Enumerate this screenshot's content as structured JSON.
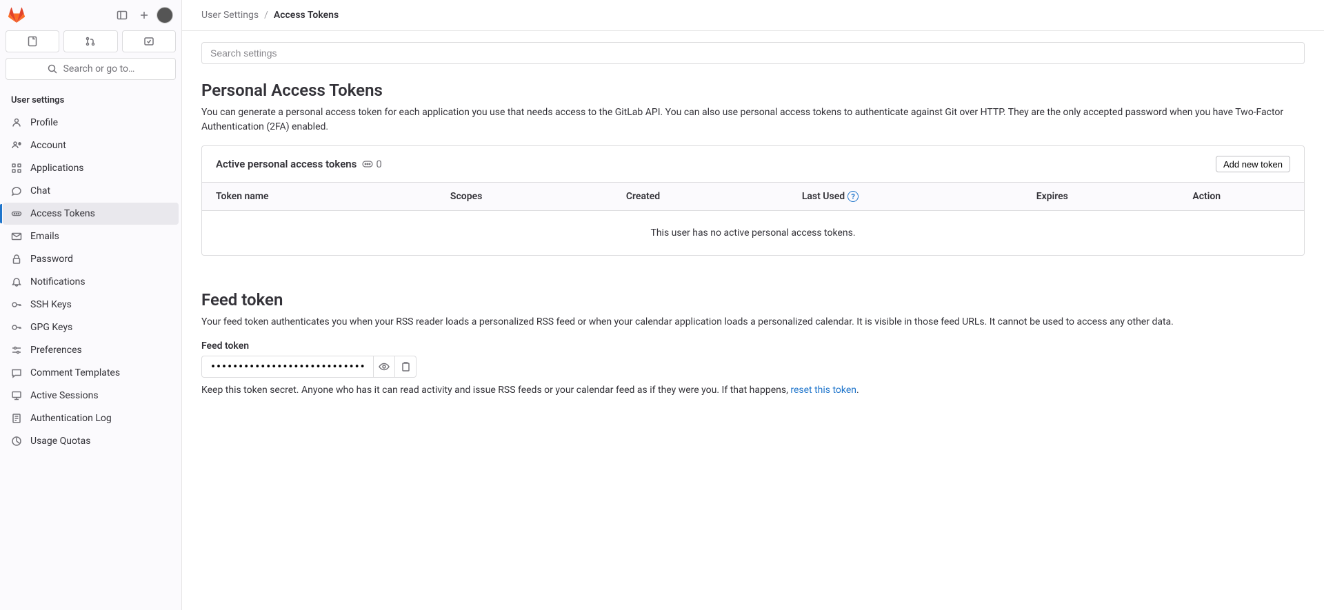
{
  "search_sidebar_label": "Search or go to…",
  "sidebar_heading": "User settings",
  "nav": {
    "profile": "Profile",
    "account": "Account",
    "applications": "Applications",
    "chat": "Chat",
    "access_tokens": "Access Tokens",
    "emails": "Emails",
    "password": "Password",
    "notifications": "Notifications",
    "ssh_keys": "SSH Keys",
    "gpg_keys": "GPG Keys",
    "preferences": "Preferences",
    "comment_templates": "Comment Templates",
    "active_sessions": "Active Sessions",
    "authentication_log": "Authentication Log",
    "usage_quotas": "Usage Quotas"
  },
  "breadcrumb": {
    "parent": "User Settings",
    "current": "Access Tokens"
  },
  "search_placeholder": "Search settings",
  "pat": {
    "heading": "Personal Access Tokens",
    "description": "You can generate a personal access token for each application you use that needs access to the GitLab API. You can also use personal access tokens to authenticate against Git over HTTP. They are the only accepted password when you have Two-Factor Authentication (2FA) enabled.",
    "active_label": "Active personal access tokens",
    "count": "0",
    "add_label": "Add new token",
    "columns": {
      "name": "Token name",
      "scopes": "Scopes",
      "created": "Created",
      "last_used": "Last Used",
      "expires": "Expires",
      "action": "Action"
    },
    "empty": "This user has no active personal access tokens."
  },
  "feed": {
    "heading": "Feed token",
    "description": "Your feed token authenticates you when your RSS reader loads a personalized RSS feed or when your calendar application loads a personalized calendar. It is visible in those feed URLs. It cannot be used to access any other data.",
    "label": "Feed token",
    "value_masked": "••••••••••••••••••••••••••••••",
    "help_prefix": "Keep this token secret. Anyone who has it can read activity and issue RSS feeds or your calendar feed as if they were you. If that happens, ",
    "reset_link": "reset this token",
    "help_suffix": "."
  }
}
